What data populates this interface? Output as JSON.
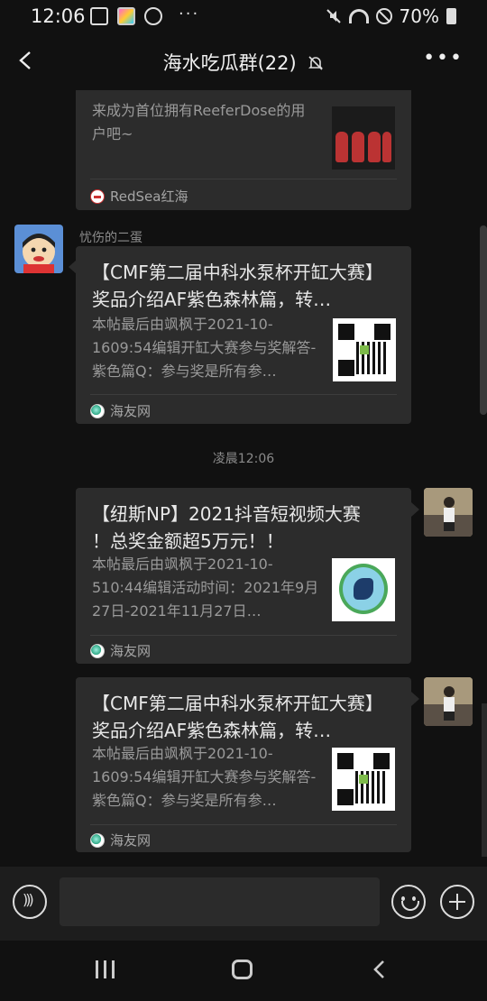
{
  "status_bar": {
    "time": "12:06",
    "battery": "70%"
  },
  "header": {
    "title": "海水吃瓜群(22)"
  },
  "messages": [
    {
      "id": "m1",
      "desc": "来成为首位拥有ReeferDose的用户吧~",
      "source": "RedSea红海"
    },
    {
      "id": "m2",
      "sender": "忧伤的二蛋",
      "title": "【CMF第二届中科水泵杯开缸大赛】奖品介绍AF紫色森林篇，转…",
      "desc": "本帖最后由飒枫于2021-10-1609:54编辑开缸大赛参与奖解答-紫色篇Q：参与奖是所有参…",
      "source": "海友网"
    },
    {
      "id": "time",
      "time": "凌晨12:06"
    },
    {
      "id": "m3",
      "title": "【纽斯NP】2021抖音短视频大赛 ！总奖金额超5万元！！",
      "desc": "本帖最后由飒枫于2021-10-510:44编辑活动时间：2021年9月27日-2021年11月27日…",
      "source": "海友网"
    },
    {
      "id": "m4",
      "title": "【CMF第二届中科水泵杯开缸大赛】奖品介绍AF紫色森林篇，转…",
      "desc": "本帖最后由飒枫于2021-10-1609:54编辑开缸大赛参与奖解答-紫色篇Q：参与奖是所有参…",
      "source": "海友网"
    }
  ],
  "input": {
    "value": ""
  },
  "icons": {
    "status_left": [
      "gallery-icon",
      "app-icon",
      "game-icon",
      "more-dots-icon"
    ],
    "status_right": [
      "mute-icon",
      "wifi-icon",
      "dnd-icon",
      "battery-icon"
    ],
    "header": [
      "back-icon",
      "bell-muted-icon",
      "more-icon"
    ],
    "input": [
      "voice-icon",
      "emoji-icon",
      "plus-icon"
    ],
    "nav": [
      "recent-apps-icon",
      "home-icon",
      "back-nav-icon"
    ]
  }
}
